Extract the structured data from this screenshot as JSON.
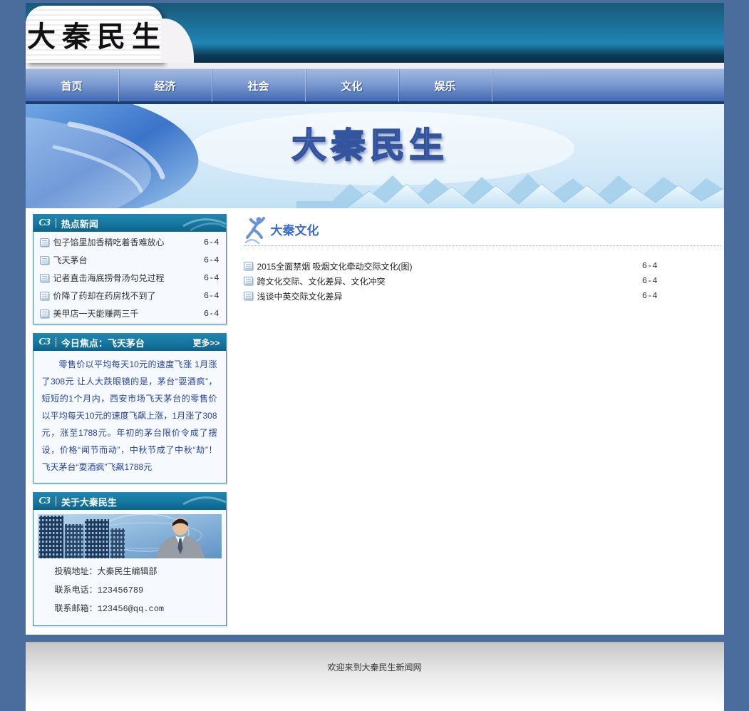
{
  "site": {
    "logo_text": "大秦民生",
    "banner_title": "大秦民生",
    "brand_mark": "C3"
  },
  "nav": {
    "items": [
      {
        "label": "首页"
      },
      {
        "label": "经济"
      },
      {
        "label": "社会"
      },
      {
        "label": "文化"
      },
      {
        "label": "娱乐"
      }
    ]
  },
  "sidebar": {
    "hot_news": {
      "title": "热点新闻",
      "items": [
        {
          "title": "包子馅里加香精吃着香难放心",
          "date": "6-4"
        },
        {
          "title": "飞天茅台",
          "date": "6-4"
        },
        {
          "title": "记者直击海底捞骨汤勾兑过程",
          "date": "6-4"
        },
        {
          "title": "价降了药却在药房找不到了",
          "date": "6-4"
        },
        {
          "title": "美甲店一天能赚两三千",
          "date": "6-4"
        }
      ]
    },
    "focus": {
      "title": "今日焦点：飞天茅台",
      "more_label": "更多>>",
      "body": "零售价以平均每天10元的速度飞涨 1月涨了308元 让人大跌眼镜的是，茅台“耍酒疯”，短短的1个月内，西安市场飞天茅台的零售价以平均每天10元的速度飞飙上涨，1月涨了308元，涨至1788元。年初的茅台限价令成了摆设，价格“闻节而动”，中秋节成了中秋“劫”！ 飞天茅台“耍酒疯”飞飙1788元"
    },
    "about": {
      "title": "关于大秦民生",
      "lines": [
        {
          "label": "投稿地址：",
          "value": "大秦民生编辑部"
        },
        {
          "label": "联系电话：",
          "value": "123456789"
        },
        {
          "label": "联系邮箱：",
          "value": "123456@qq.com"
        }
      ]
    }
  },
  "main": {
    "section_title": "大秦文化",
    "articles": [
      {
        "title": "2015全面禁烟 吸烟文化牵动交际文化(图)",
        "date": "6-4"
      },
      {
        "title": "跨文化交际、文化差异、文化冲突",
        "date": "6-4"
      },
      {
        "title": "浅谈中英交际文化差异",
        "date": "6-4"
      }
    ]
  },
  "footer": {
    "text": "欢迎来到大秦民生新闻网"
  },
  "colors": {
    "page_bg": "#4a6d9e",
    "header_teal": "#1f85b3",
    "header_teal_dark": "#0a2c44",
    "nav_blue_top": "#a3badf",
    "nav_blue_bottom": "#3c63b0",
    "panel_header_teal": "#15779f",
    "panel_border": "#3c7cbc",
    "focus_text": "#26439c",
    "section_title_blue": "#3a6cc8",
    "body_text": "#333333"
  }
}
